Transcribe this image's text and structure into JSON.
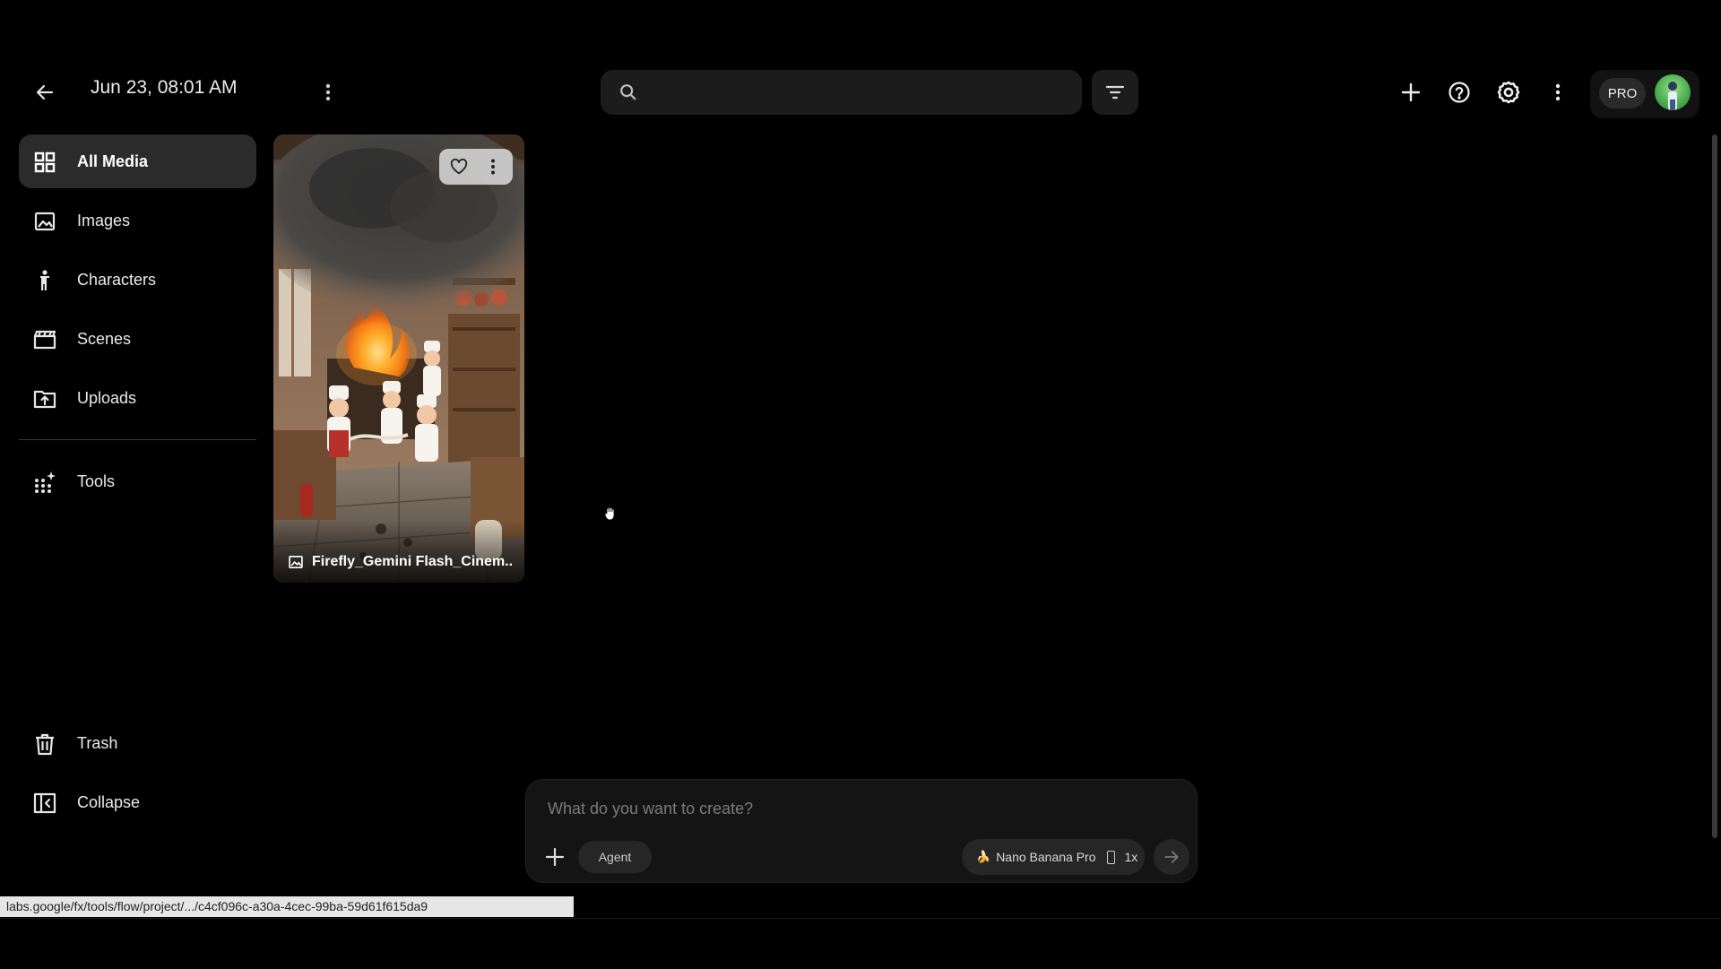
{
  "header": {
    "project_title": "Jun 23, 08:01 AM",
    "search_placeholder": "",
    "account_badge": "PRO"
  },
  "sidebar": {
    "items": [
      {
        "label": "All Media",
        "icon": "grid-icon",
        "active": true
      },
      {
        "label": "Images",
        "icon": "image-icon"
      },
      {
        "label": "Characters",
        "icon": "person-icon"
      },
      {
        "label": "Scenes",
        "icon": "clapperboard-icon"
      },
      {
        "label": "Uploads",
        "icon": "upload-folder-icon"
      },
      {
        "label": "Tools",
        "icon": "sparkle-grid-icon"
      }
    ],
    "footer": [
      {
        "label": "Trash",
        "icon": "trash-icon"
      },
      {
        "label": "Collapse",
        "icon": "collapse-panel-icon"
      }
    ]
  },
  "media": {
    "items": [
      {
        "title": "Firefly_Gemini Flash_Cinem...",
        "type_icon": "image-icon",
        "favorite": false
      }
    ]
  },
  "prompt": {
    "placeholder": "What do you want to create?",
    "agent_label": "Agent",
    "model_emoji": "🍌",
    "model_name": "Nano Banana Pro",
    "count": "1x"
  },
  "status_url": "labs.google/fx/tools/flow/project/.../c4cf096c-a30a-4cec-99ba-59d61f615da9",
  "colors": {
    "background": "#000000",
    "active_nav": "#2b2b2b",
    "panel": "#1c1c1c",
    "avatar_green": "#4caf50"
  }
}
